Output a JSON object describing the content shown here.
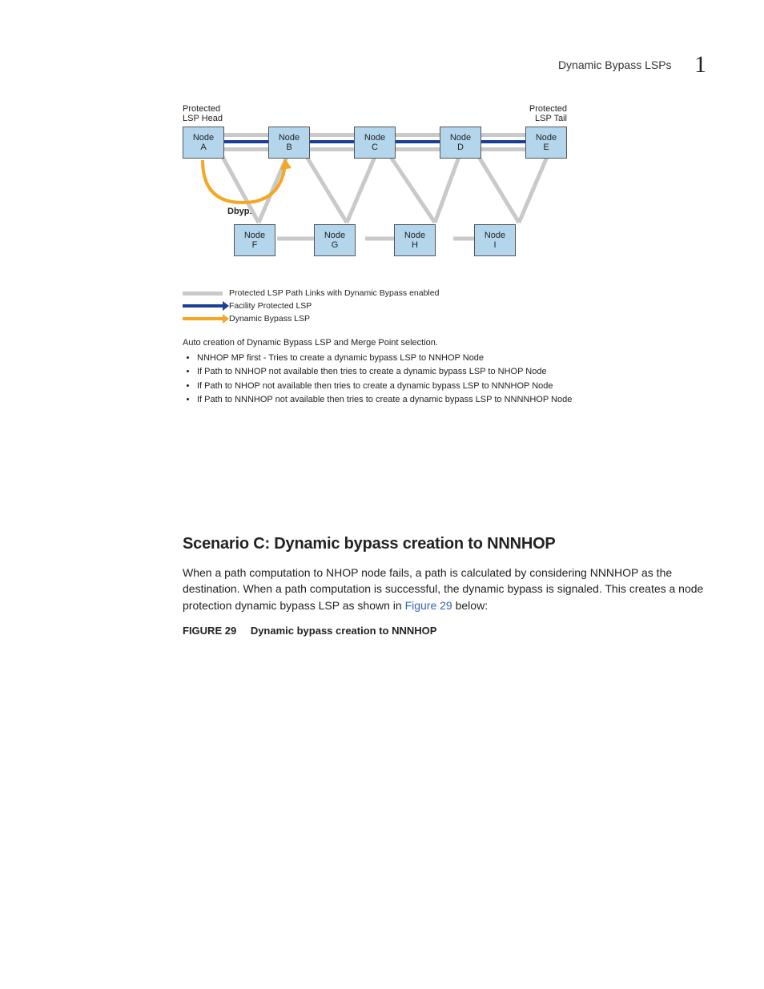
{
  "header": {
    "title": "Dynamic Bypass LSPs",
    "chapter": "1"
  },
  "diagram": {
    "top_labels": {
      "left": "Protected\nLSP Head",
      "right": "Protected\nLSP Tail"
    },
    "row1": [
      "Node\nA",
      "Node\nB",
      "Node\nC",
      "Node\nD",
      "Node\nE"
    ],
    "row2": [
      "Node\nF",
      "Node\nG",
      "Node\nH",
      "Node\nI"
    ],
    "dbyp_label": "Dbyp1"
  },
  "legend": {
    "items": [
      {
        "swatch": "gray",
        "text": "Protected LSP Path Links with Dynamic Bypass enabled"
      },
      {
        "swatch": "blue",
        "text": "Facility Protected LSP"
      },
      {
        "swatch": "orange",
        "text": "Dynamic Bypass LSP"
      }
    ]
  },
  "notes": {
    "intro": "Auto creation of Dynamic Bypass LSP and Merge Point selection.",
    "bullets": [
      "NNHOP MP first - Tries to create a dynamic bypass LSP to NNHOP Node",
      "If Path to NNHOP not available then tries to create a dynamic bypass LSP to NHOP Node",
      "If Path to NHOP not available then tries to create a dynamic bypass LSP to NNNHOP Node",
      "If Path to NNNHOP not available then tries to create a dynamic bypass LSP to NNNNHOP Node"
    ]
  },
  "section": {
    "title": "Scenario C: Dynamic bypass creation to NNNHOP",
    "body_before_ref": "When a path computation to NHOP node fails, a path is calculated by considering NNNHOP as the destination. When a path computation is successful, the dynamic bypass is signaled. This creates a node protection dynamic bypass LSP as shown in ",
    "fig_ref": "Figure 29",
    "body_after_ref": " below:"
  },
  "figure": {
    "label": "FIGURE 29",
    "title": "Dynamic bypass creation to NNNHOP"
  }
}
